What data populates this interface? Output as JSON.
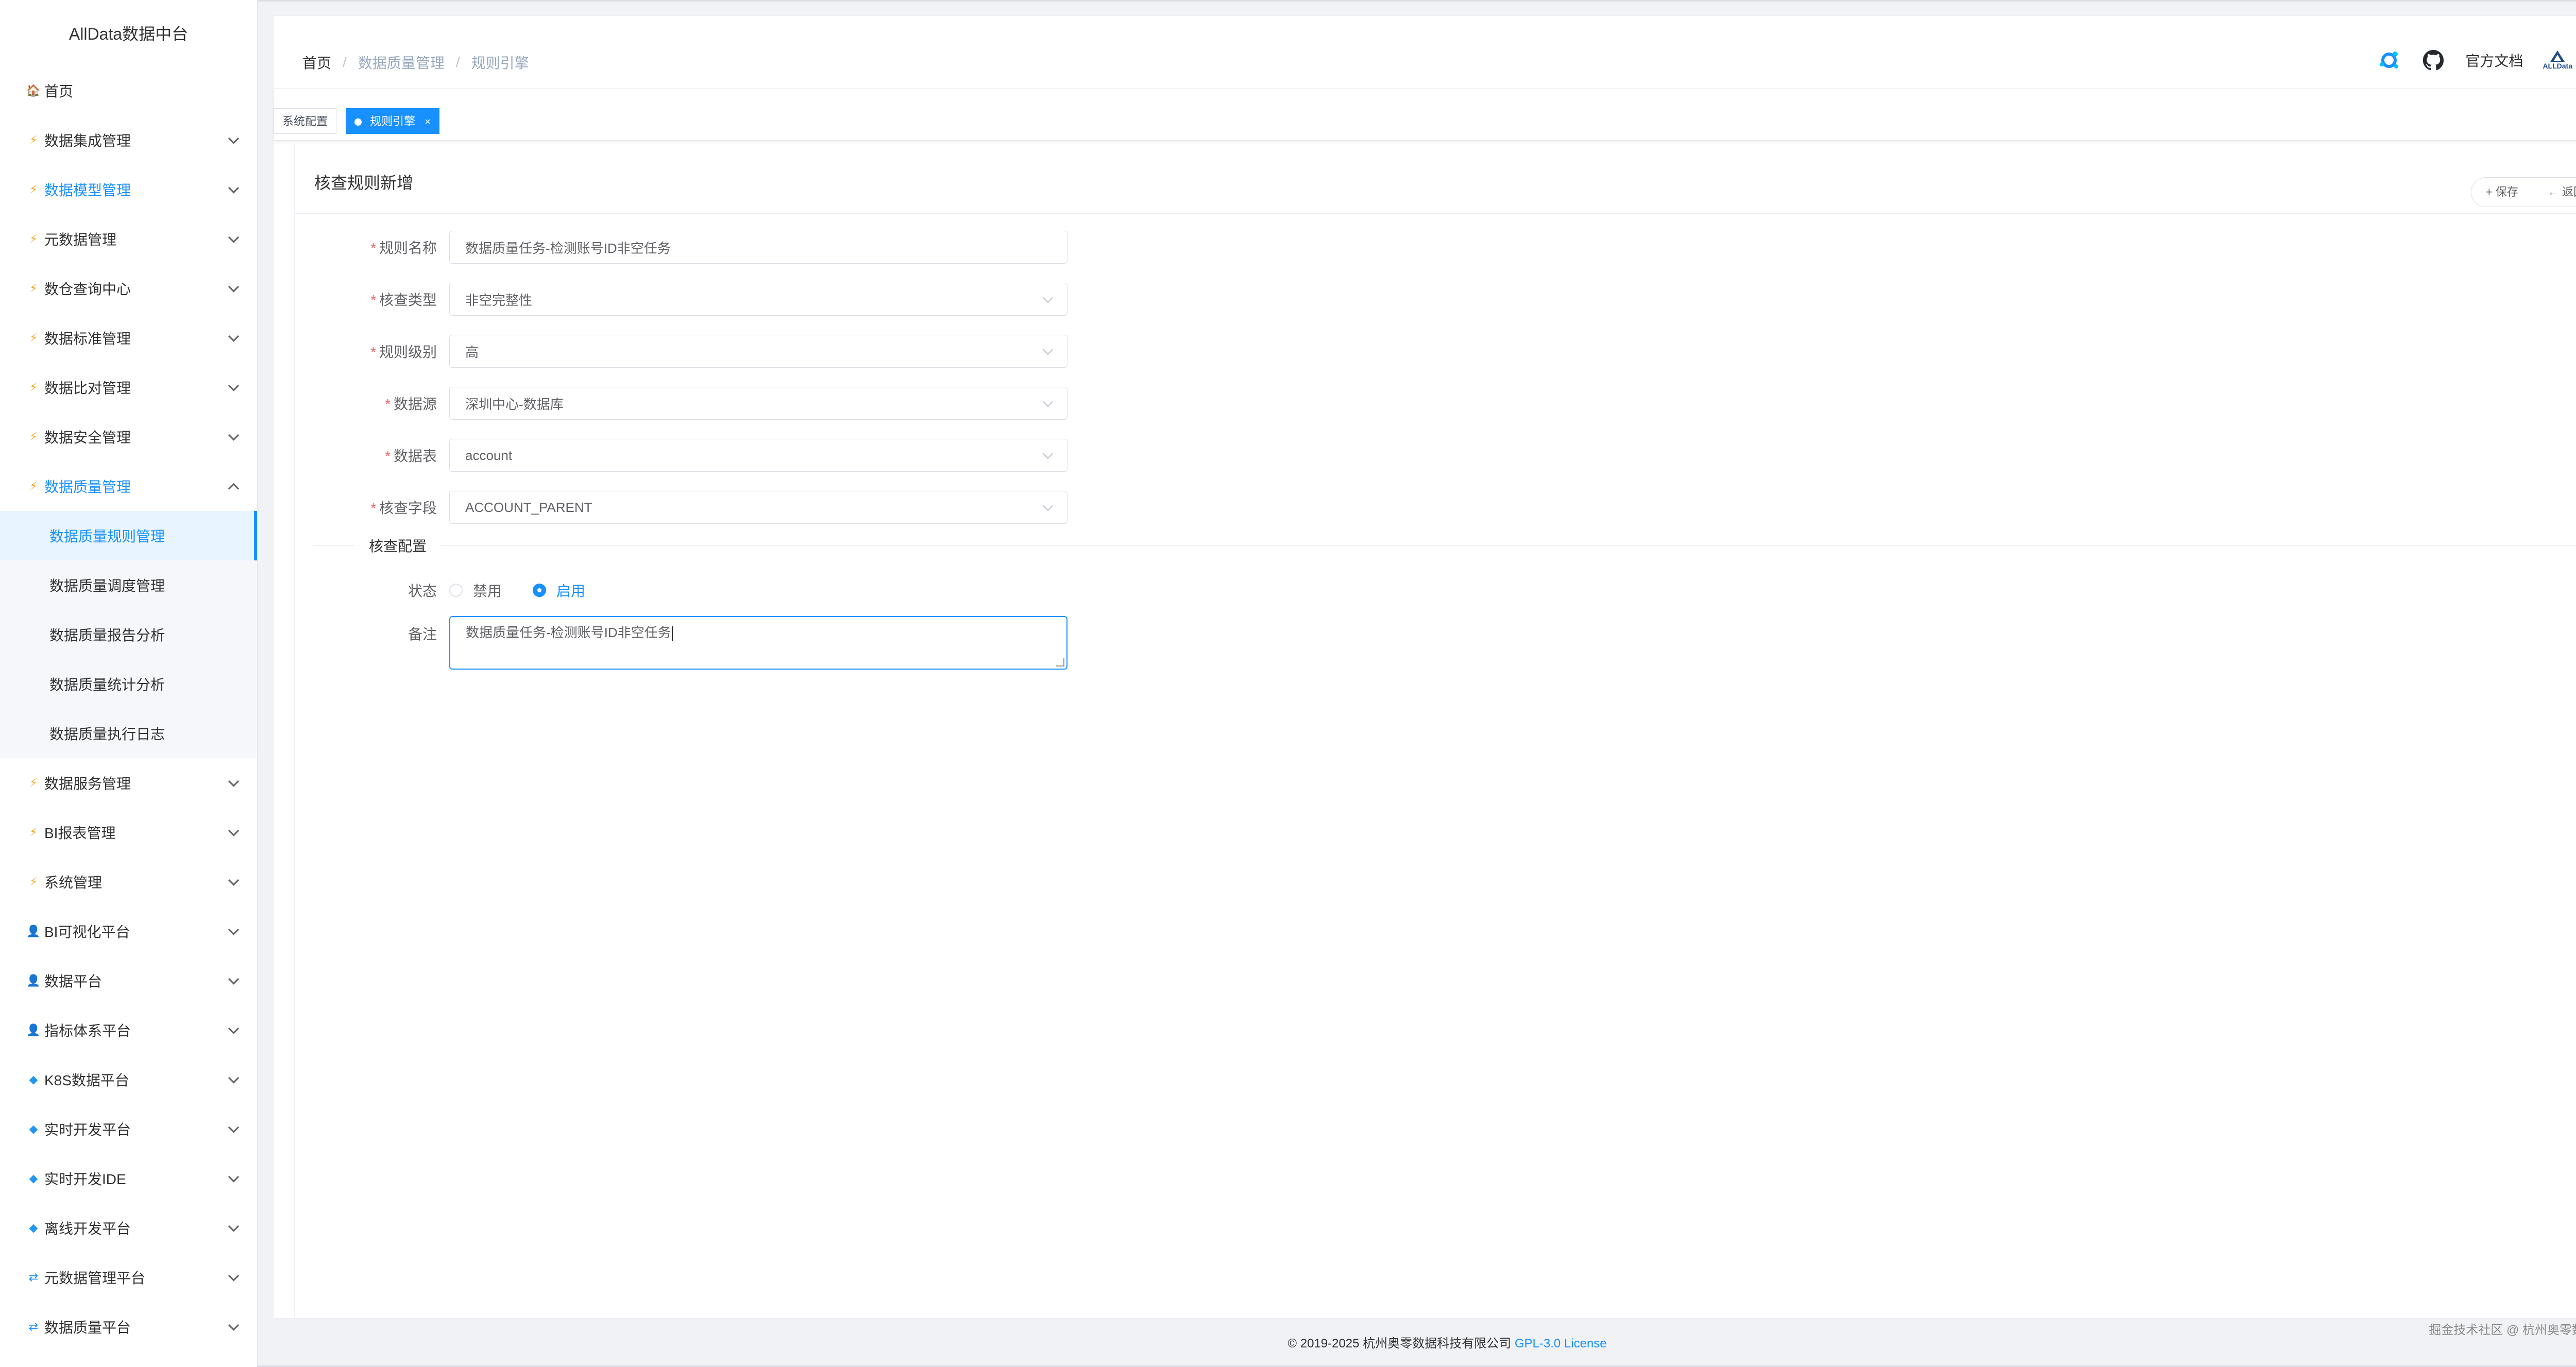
{
  "app": {
    "title": "AllData数据中台"
  },
  "sidebar": {
    "items": [
      {
        "label": "首页",
        "icon": "home-icon",
        "glyph": "🏠",
        "cls": "ic-home",
        "expandable": false
      },
      {
        "label": "数据集成管理",
        "icon": "bolt-icon",
        "glyph": "⚡",
        "cls": "ic-bolt",
        "expandable": true
      },
      {
        "label": "数据模型管理",
        "icon": "bolt-icon",
        "glyph": "⚡",
        "cls": "ic-bolt",
        "expandable": true,
        "highlight": true
      },
      {
        "label": "元数据管理",
        "icon": "bolt-icon",
        "glyph": "⚡",
        "cls": "ic-bolt",
        "expandable": true
      },
      {
        "label": "数仓查询中心",
        "icon": "bolt-icon",
        "glyph": "⚡",
        "cls": "ic-bolt",
        "expandable": true
      },
      {
        "label": "数据标准管理",
        "icon": "bolt-icon",
        "glyph": "⚡",
        "cls": "ic-bolt",
        "expandable": true
      },
      {
        "label": "数据比对管理",
        "icon": "bolt-icon",
        "glyph": "⚡",
        "cls": "ic-bolt",
        "expandable": true
      },
      {
        "label": "数据安全管理",
        "icon": "bolt-icon",
        "glyph": "⚡",
        "cls": "ic-bolt",
        "expandable": true
      },
      {
        "label": "数据质量管理",
        "icon": "bolt-icon",
        "glyph": "⚡",
        "cls": "ic-bolt",
        "expandable": true,
        "expanded": true,
        "highlight": true,
        "children": [
          {
            "label": "数据质量规则管理",
            "active": true
          },
          {
            "label": "数据质量调度管理"
          },
          {
            "label": "数据质量报告分析"
          },
          {
            "label": "数据质量统计分析"
          },
          {
            "label": "数据质量执行日志"
          }
        ]
      },
      {
        "label": "数据服务管理",
        "icon": "bolt-icon",
        "glyph": "⚡",
        "cls": "ic-bolt",
        "expandable": true
      },
      {
        "label": "BI报表管理",
        "icon": "bolt-icon",
        "glyph": "⚡",
        "cls": "ic-bolt",
        "expandable": true
      },
      {
        "label": "系统管理",
        "icon": "bolt-icon",
        "glyph": "⚡",
        "cls": "ic-bolt",
        "expandable": true
      },
      {
        "label": "BI可视化平台",
        "icon": "user-icon",
        "glyph": "👤",
        "cls": "ic-user",
        "expandable": true
      },
      {
        "label": "数据平台",
        "icon": "user-icon",
        "glyph": "👤",
        "cls": "ic-user",
        "expandable": true
      },
      {
        "label": "指标体系平台",
        "icon": "user-icon",
        "glyph": "👤",
        "cls": "ic-user",
        "expandable": true
      },
      {
        "label": "K8S数据平台",
        "icon": "diamond-icon",
        "glyph": "◆",
        "cls": "ic-diam",
        "expandable": true
      },
      {
        "label": "实时开发平台",
        "icon": "diamond-icon",
        "glyph": "◆",
        "cls": "ic-diam",
        "expandable": true
      },
      {
        "label": "实时开发IDE",
        "icon": "diamond-icon",
        "glyph": "◆",
        "cls": "ic-diam",
        "expandable": true
      },
      {
        "label": "离线开发平台",
        "icon": "diamond-icon",
        "glyph": "◆",
        "cls": "ic-diam",
        "expandable": true
      },
      {
        "label": "元数据管理平台",
        "icon": "sync-icon",
        "glyph": "⇄",
        "cls": "ic-sync",
        "expandable": true
      },
      {
        "label": "数据质量平台",
        "icon": "sync-icon",
        "glyph": "⇄",
        "cls": "ic-sync",
        "expandable": true
      }
    ]
  },
  "header": {
    "breadcrumb": [
      "首页",
      "数据质量管理",
      "规则引擎"
    ],
    "docs_label": "官方文档",
    "avatar_text": "ALLData"
  },
  "tags": [
    {
      "label": "系统配置",
      "active": false
    },
    {
      "label": "规则引擎",
      "active": true,
      "close": "×"
    }
  ],
  "card": {
    "title": "核查规则新增",
    "save_label": "+ 保存",
    "back_label": "← 返回"
  },
  "form": {
    "fields": [
      {
        "label": "规则名称",
        "required": true,
        "value": "数据质量任务-检测账号ID非空任务",
        "type": "input"
      },
      {
        "label": "核查类型",
        "required": true,
        "value": "非空完整性",
        "type": "select"
      },
      {
        "label": "规则级别",
        "required": true,
        "value": "高",
        "type": "select"
      },
      {
        "label": "数据源",
        "required": true,
        "value": "深圳中心-数据库",
        "type": "select"
      },
      {
        "label": "数据表",
        "required": true,
        "value": "account",
        "type": "select"
      },
      {
        "label": "核查字段",
        "required": true,
        "value": "ACCOUNT_PARENT",
        "type": "select"
      }
    ],
    "section_title": "核查配置",
    "status": {
      "label": "状态",
      "options": [
        "禁用",
        "启用"
      ],
      "selected": "启用"
    },
    "remark": {
      "label": "备注",
      "value": "数据质量任务-检测账号ID非空任务"
    }
  },
  "footer": {
    "copyright": "© 2019-2025 杭州奥零数据科技有限公司",
    "license": "GPL-3.0 License",
    "watermark": "掘金技术社区 @ 杭州奥零数据科技"
  },
  "colors": {
    "accent": "#1890ff",
    "required": "#f56c6c",
    "bolt": "#f5a623"
  }
}
